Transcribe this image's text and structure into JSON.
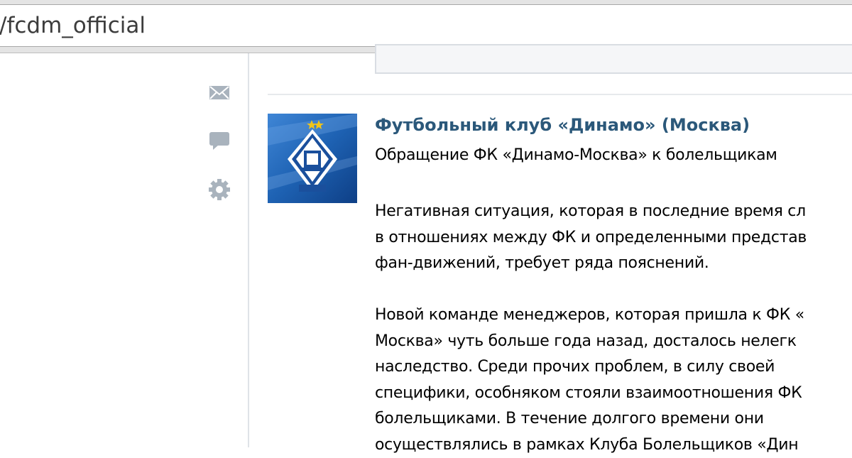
{
  "address_bar": {
    "url": "/fcdm_official"
  },
  "sidebar": {
    "icons": [
      {
        "name": "mail-icon"
      },
      {
        "name": "comment-icon"
      },
      {
        "name": "gear-icon"
      }
    ]
  },
  "post": {
    "author": "Футбольный клуб «Динамо» (Москва)",
    "subtitle": "Обращение ФК «Динамо-Москва» к болельщикам",
    "body_lines": [
      "Негативная ситуация, которая в последние время сл",
      "в отношениях между ФК и определенными представ",
      "фан-движений, требует ряда пояснений.",
      "",
      "Новой команде менеджеров, которая пришла к ФК «",
      "Москва» чуть больше года назад, досталось нелегк",
      "наследство. Среди прочих проблем, в силу своей",
      "специфики, особняком стояли взаимоотношения ФК",
      "болельщиками. В течение долгого времени они",
      "осуществлялись в рамках Клуба Болельщиков «Дин"
    ]
  },
  "colors": {
    "author_link": "#2b587a",
    "icon_gray": "#a9b3bd",
    "avatar_blue": "#1f63b4"
  }
}
